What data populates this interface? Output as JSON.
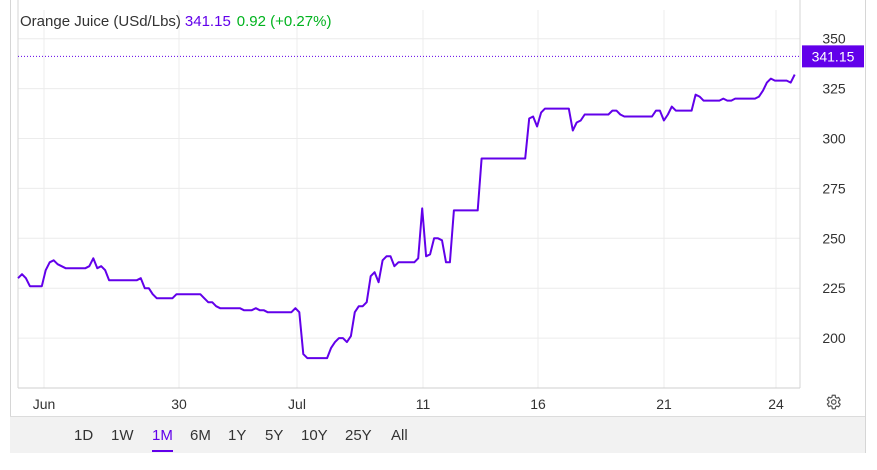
{
  "header": {
    "name": "Orange Juice (USd/Lbs)",
    "price": "341.15",
    "change": "0.92 (+0.27%)"
  },
  "colors": {
    "line": "#6200ea",
    "change_positive": "#00b31e",
    "grid": "#ececec"
  },
  "last_price_label": "341.15",
  "ranges": [
    "1D",
    "1W",
    "1M",
    "6M",
    "1Y",
    "5Y",
    "10Y",
    "25Y",
    "All"
  ],
  "active_range": "1M",
  "settings_icon": "gear-icon",
  "chart_data": {
    "type": "line",
    "title": "Orange Juice (USd/Lbs)",
    "ylim": [
      175,
      350
    ],
    "yticks": [
      200,
      225,
      250,
      275,
      300,
      325,
      350
    ],
    "xticks": [
      "Jun",
      "30",
      "Jul",
      "11",
      "16",
      "21",
      "24"
    ],
    "grid": true,
    "y_axis_side": "right",
    "last_value": 341.15,
    "x": [
      0,
      1,
      2,
      3,
      4,
      5,
      6,
      7,
      8,
      9,
      10,
      11,
      12,
      13,
      14,
      15,
      16,
      17,
      18,
      19,
      20,
      21,
      22,
      23,
      24,
      25,
      26,
      27,
      28,
      29,
      30,
      31,
      32,
      33,
      34,
      35,
      36,
      37,
      38,
      39,
      40,
      41,
      42,
      43,
      44,
      45,
      46,
      47,
      48,
      49,
      50,
      51,
      52,
      53,
      54,
      55,
      56,
      57,
      58,
      59,
      60,
      61,
      62,
      63,
      64,
      65,
      66,
      67,
      68,
      69,
      70,
      71,
      72,
      73,
      74,
      75,
      76,
      77,
      78,
      79,
      80,
      81,
      82,
      83,
      84,
      85,
      86,
      87,
      88,
      89,
      90,
      91,
      92,
      93,
      94,
      95,
      96,
      97,
      98,
      99,
      100,
      101,
      102,
      103,
      104,
      105,
      106,
      107,
      108,
      109,
      110,
      111,
      112,
      113,
      114,
      115,
      116,
      117,
      118,
      119,
      120,
      121,
      122,
      123,
      124,
      125,
      126,
      127,
      128,
      129,
      130,
      131,
      132,
      133,
      134,
      135,
      136,
      137,
      138,
      139,
      140,
      141,
      142,
      143,
      144,
      145,
      146,
      147,
      148,
      149,
      150,
      151,
      152,
      153,
      154,
      155,
      156,
      157,
      158,
      159,
      160,
      161,
      162,
      163,
      164,
      165,
      166,
      167,
      168,
      169,
      170,
      171,
      172,
      173,
      174,
      175,
      176,
      177,
      178,
      179,
      180,
      181,
      182,
      183,
      184,
      185,
      186,
      187,
      188,
      189,
      190,
      191,
      192,
      193,
      194,
      195,
      196
    ],
    "series": [
      {
        "values": [
          230,
          232,
          230,
          226,
          226,
          226,
          226,
          234,
          238,
          239,
          237,
          236,
          235,
          235,
          235,
          235,
          235,
          235,
          236,
          240,
          235,
          236,
          234,
          229,
          229,
          229,
          229,
          229,
          229,
          229,
          229,
          230,
          225,
          225,
          222,
          220,
          220,
          220,
          220,
          220,
          222,
          222,
          222,
          222,
          222,
          222,
          222,
          220,
          218,
          218,
          216,
          215,
          215,
          215,
          215,
          215,
          215,
          214,
          214,
          214,
          215,
          214,
          214,
          213,
          213,
          213,
          213,
          213,
          213,
          213,
          215,
          213,
          192,
          190,
          190,
          190,
          190,
          190,
          190,
          195,
          198,
          200,
          200,
          198,
          201,
          213,
          216,
          216,
          218,
          231,
          233,
          228,
          239,
          241,
          241,
          236,
          238,
          238,
          238,
          238,
          238,
          240,
          265,
          241,
          242,
          250,
          250,
          249,
          238,
          238,
          264,
          264,
          264,
          264,
          264,
          264,
          264,
          290,
          290,
          290,
          290,
          290,
          290,
          290,
          290,
          290,
          290,
          290,
          290,
          310,
          311,
          306,
          313,
          315,
          315,
          315,
          315,
          315,
          315,
          315,
          304,
          308,
          309,
          312,
          312,
          312,
          312,
          312,
          312,
          312,
          314,
          314,
          312,
          311,
          311,
          311,
          311,
          311,
          311,
          311,
          311,
          314,
          314,
          309,
          312,
          316,
          314,
          314,
          314,
          314,
          314,
          322,
          321,
          319,
          319,
          319,
          319,
          319,
          320,
          319,
          319,
          320,
          320,
          320,
          320,
          320,
          320,
          321,
          324,
          328,
          330,
          329,
          329,
          329,
          329,
          328,
          332,
          334,
          333,
          332,
          332,
          332,
          332,
          332,
          332,
          332,
          335,
          338,
          333,
          336,
          338,
          338,
          338,
          339,
          338,
          341.15,
          341.15
        ]
      }
    ]
  }
}
